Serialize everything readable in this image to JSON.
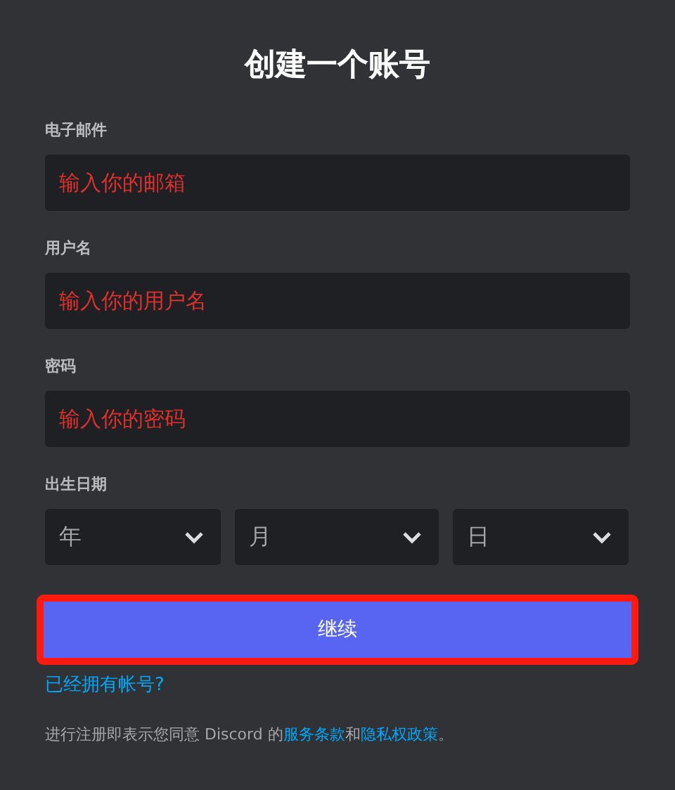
{
  "title": "创建一个账号",
  "fields": [
    {
      "label": "电子邮件",
      "placeholder": "输入你的邮箱"
    },
    {
      "label": "用户名",
      "placeholder": "输入你的用户名"
    },
    {
      "label": "密码",
      "placeholder": "输入你的密码"
    }
  ],
  "birthdate": {
    "label": "出生日期",
    "selects": [
      {
        "placeholder": "年"
      },
      {
        "placeholder": "月"
      },
      {
        "placeholder": "日"
      }
    ]
  },
  "continue_button": {
    "label": "继续",
    "highlighted": true
  },
  "login_link": "已经拥有帐号?",
  "terms": [
    {
      "kind": "text",
      "text": "进行注册即表示您同意 Discord 的"
    },
    {
      "kind": "link",
      "text": "服务条款"
    },
    {
      "kind": "text",
      "text": "和"
    },
    {
      "kind": "link",
      "text": "隐私权政策"
    },
    {
      "kind": "text",
      "text": "。"
    }
  ]
}
